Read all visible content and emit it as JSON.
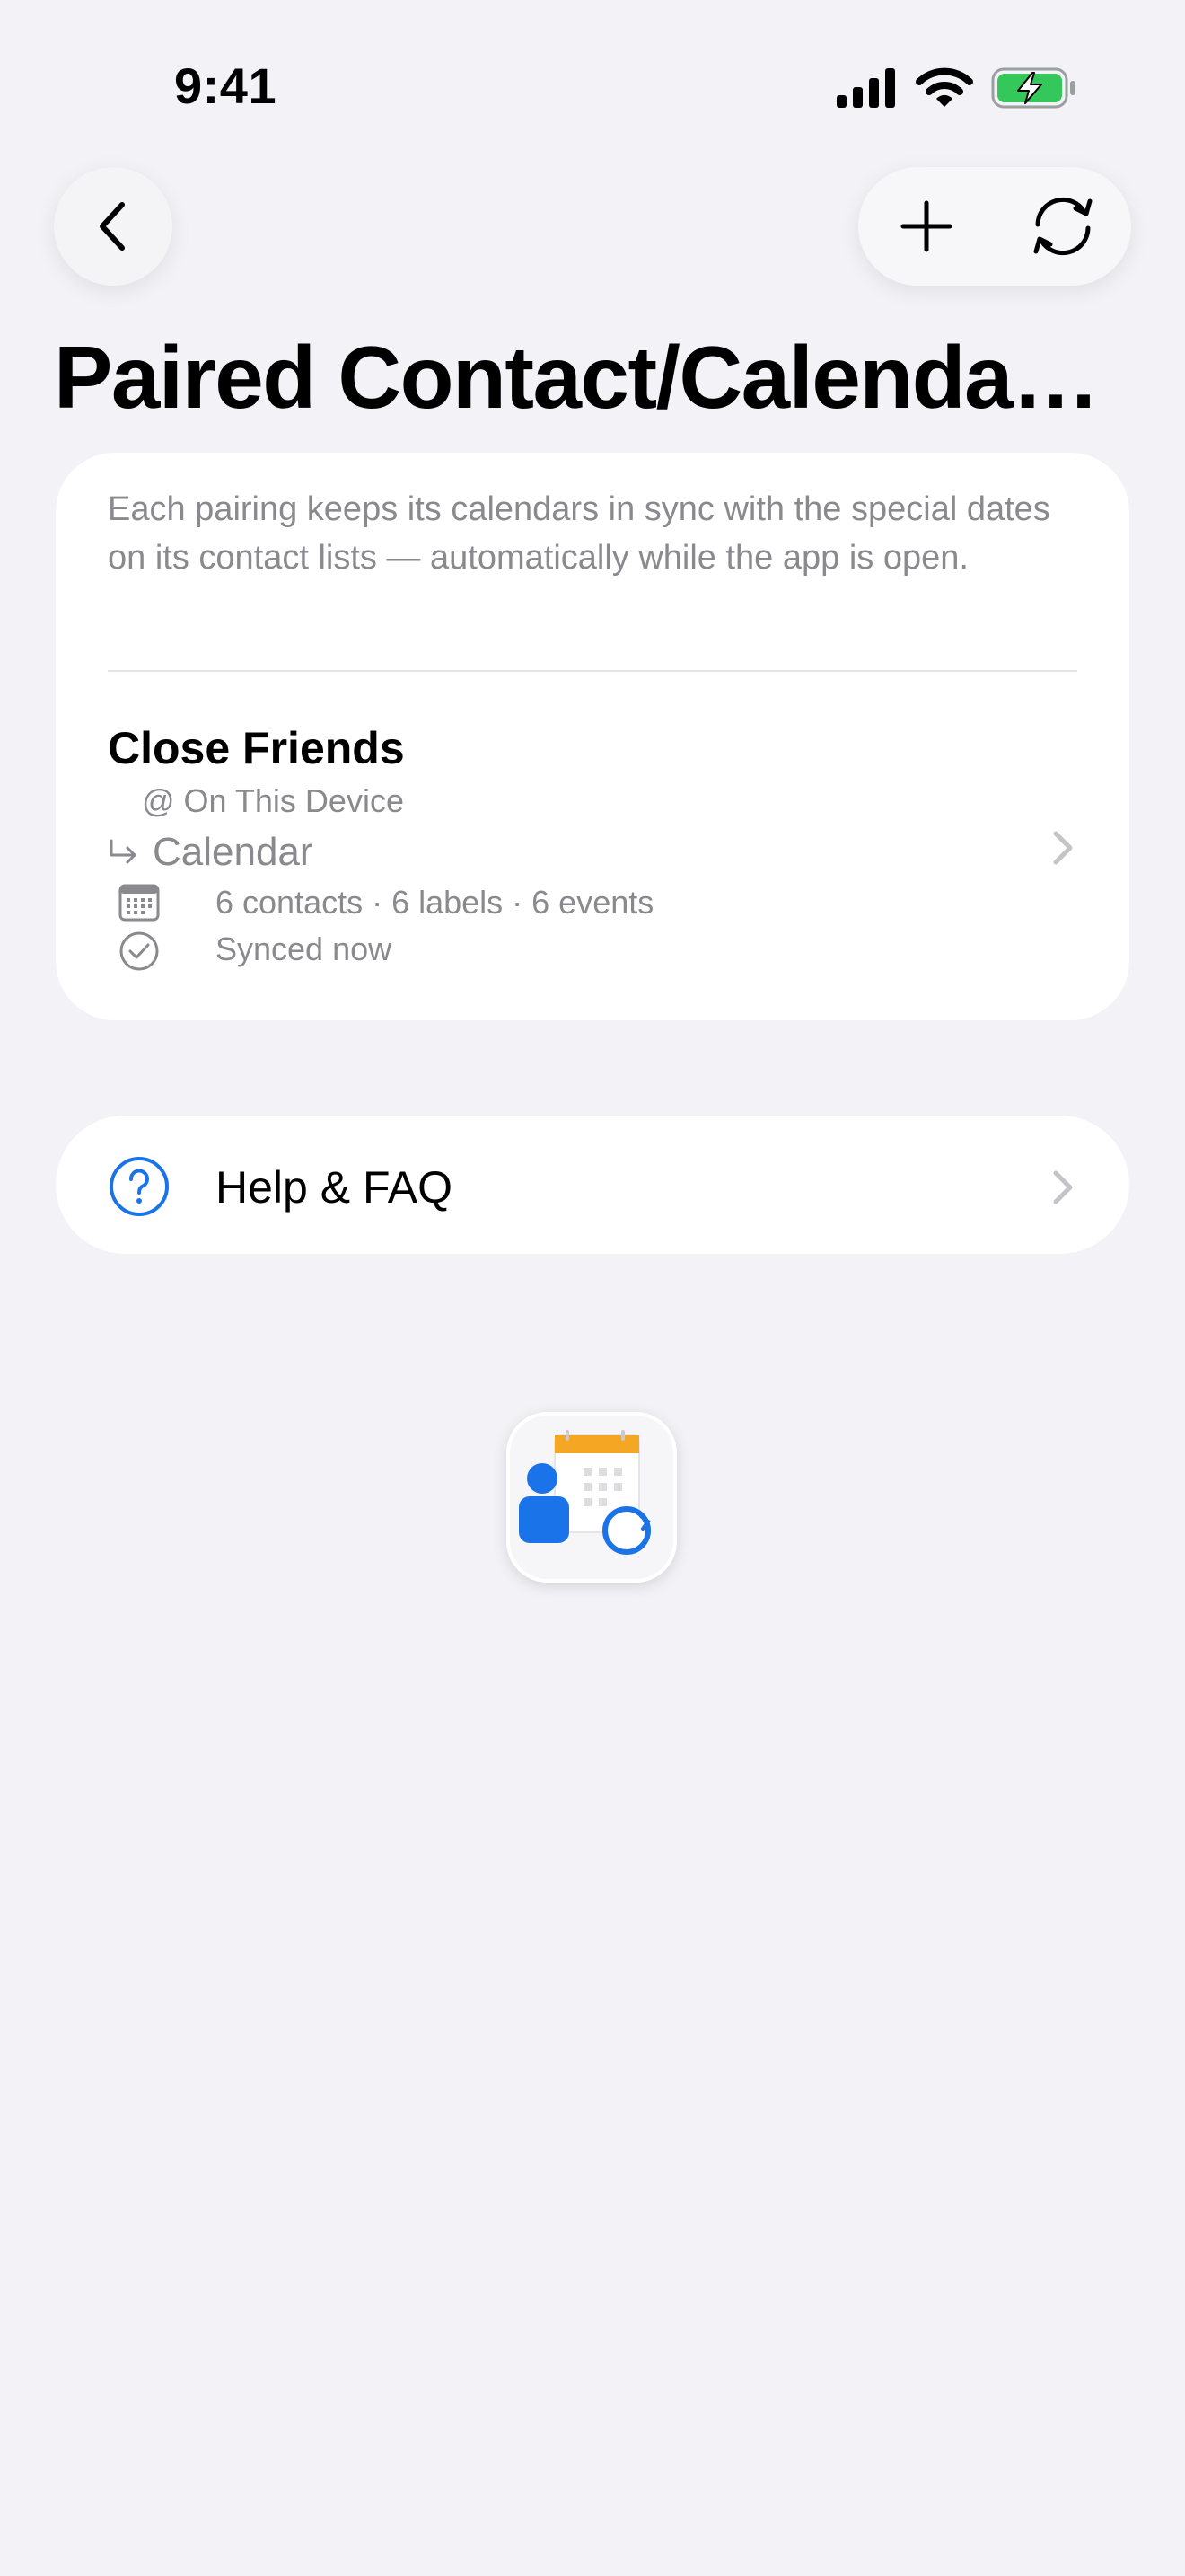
{
  "status_bar": {
    "time": "9:41",
    "icons": [
      "cellular-signal-icon",
      "wifi-icon",
      "battery-charging-icon"
    ]
  },
  "nav": {
    "back_icon": "chevron-left-icon",
    "add_icon": "plus-icon",
    "sync_icon": "sync-arrows-icon"
  },
  "page": {
    "title": "Paired Contact/Calenda…"
  },
  "pairings_card": {
    "intro": "Each pairing keeps its calendars in sync with the special dates on its contact lists — automatically while the app is open.",
    "rows": [
      {
        "title": "Close Friends",
        "account": "@ On This Device",
        "target": "Calendar",
        "stats": "6 contacts · 6 labels · 6 events",
        "sync_status": "Synced now"
      }
    ]
  },
  "help": {
    "label": "Help & FAQ",
    "icon": "question-circle-icon"
  },
  "colors": {
    "background": "#f2f2f7",
    "card": "#ffffff",
    "secondary_text": "#8a8a8e",
    "accent_blue": "#1a73e8",
    "icon_orange": "#f5a623",
    "battery_green": "#34c759"
  }
}
